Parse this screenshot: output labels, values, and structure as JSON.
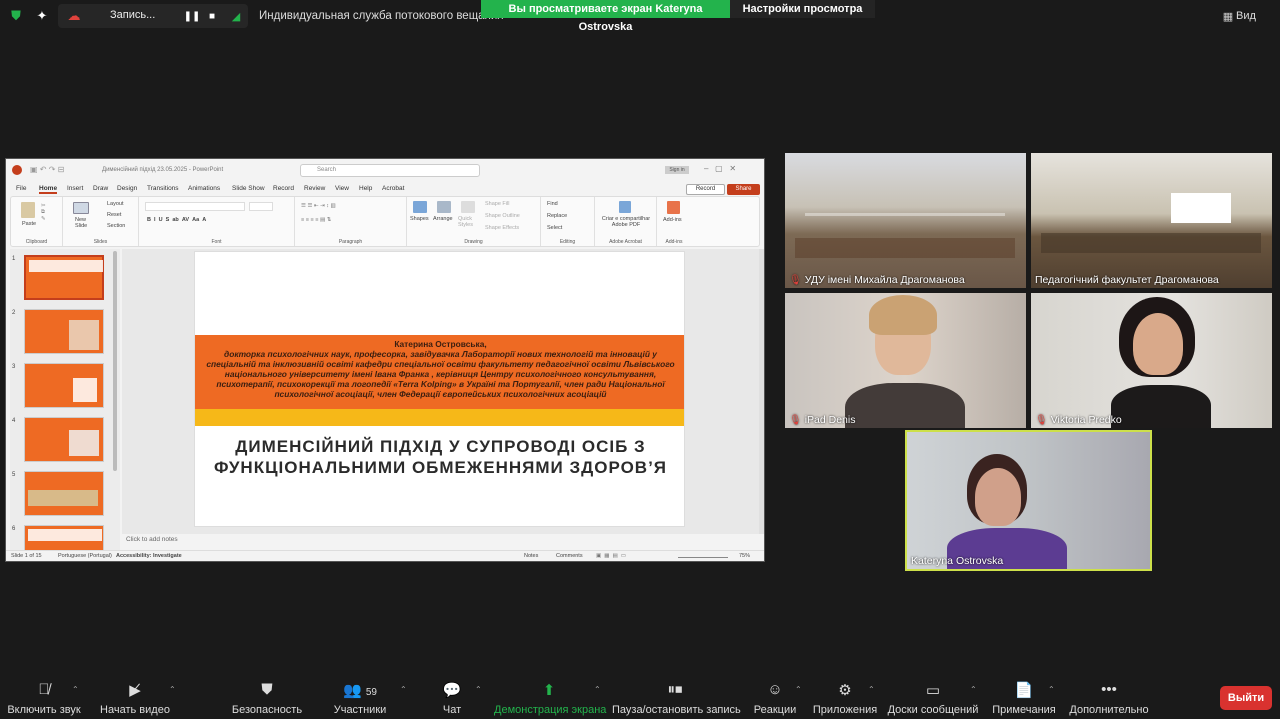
{
  "topbar": {
    "recording_label": "Запись...",
    "stream_text": "Индивидуальная служба потокового вещания",
    "share_banner": "Вы просматриваете экран Kateryna Ostrovska",
    "view_settings": "Настройки просмотра",
    "view_label": "Вид"
  },
  "ppt": {
    "doc_title": "Дименсійний підхід 23.05.2025 - PowerPoint",
    "search_placeholder": "Search",
    "sign_in": "Sign in",
    "tabs": [
      "File",
      "Home",
      "Insert",
      "Draw",
      "Design",
      "Transitions",
      "Animations",
      "Slide Show",
      "Record",
      "Review",
      "View",
      "Help",
      "Acrobat"
    ],
    "record_btn": "Record",
    "share_btn": "Share",
    "ribbon": {
      "clipboard": {
        "paste": "Paste",
        "label": "Clipboard"
      },
      "slides": {
        "new_slide": "New Slide",
        "layout": "Layout",
        "reset": "Reset",
        "section": "Section",
        "label": "Slides"
      },
      "font": {
        "label": "Font"
      },
      "paragraph": {
        "label": "Paragraph"
      },
      "drawing": {
        "shapes": "Shapes",
        "arrange": "Arrange",
        "quick_styles": "Quick Styles",
        "shape_fill": "Shape Fill",
        "shape_outline": "Shape Outline",
        "shape_effects": "Shape Effects",
        "label": "Drawing"
      },
      "editing": {
        "find": "Find",
        "replace": "Replace",
        "select": "Select",
        "label": "Editing"
      },
      "adobe": {
        "create": "Criar e compartilhar Adobe PDF",
        "label": "Adobe Acrobat"
      },
      "addins": {
        "addins": "Add-ins",
        "label": "Add-ins"
      }
    },
    "thumb_numbers": [
      "1",
      "2",
      "3",
      "4",
      "5",
      "6"
    ],
    "slide": {
      "author_name": "Катерина Островська,",
      "author_desc": "докторка психологічних наук, професорка, завідувачка Лабораторії нових технологій та інновацій у спеціальній та інклюзивній освіті кафедри спеціальної освіти факультету педагогічної освіти Львівського національного університету імені Івана Франка , керівниця Центру психологічного консультування, психотерапії, психокорекції та логопедії «Terra Kolping» в Україні та Португалії, член ради Національної психологічної асоціації, член Федерації європейських психологічних асоціацій",
      "title": "ДИМЕНСІЙНИЙ ПІДХІД У СУПРОВОДІ ОСІБ З ФУНКЦІОНАЛЬНИМИ ОБМЕЖЕННЯМИ ЗДОРОВ’Я"
    },
    "notes_placeholder": "Click to add notes",
    "status": {
      "slide_count": "Slide 1 of 15",
      "language": "Portuguese (Portugal)",
      "accessibility": "Accessibility: Investigate",
      "notes": "Notes",
      "comments": "Comments",
      "zoom": "75%"
    }
  },
  "tiles": [
    {
      "name": "УДУ імені Михайла Драгоманова"
    },
    {
      "name": "Педагогічний факультет Драгоманова"
    },
    {
      "name": "iPad Denis"
    },
    {
      "name": "Viktoria Predko"
    },
    {
      "name": "Kateryna Ostrovska"
    }
  ],
  "bottombar": {
    "mute": "Включить звук",
    "video": "Начать видео",
    "security": "Безопасность",
    "participants": "Участники",
    "participants_count": "59",
    "chat": "Чат",
    "share": "Демонстрация экрана",
    "pause_rec": "Пауза/остановить запись",
    "reactions": "Реакции",
    "apps": "Приложения",
    "whiteboards": "Доски сообщений",
    "notes": "Примечания",
    "more": "Дополнительно",
    "leave": "Выйти"
  },
  "colors": {
    "share_green": "#23b34c",
    "ppt_accent": "#c43e1c",
    "slide_orange": "#ee6a23",
    "slide_yellow": "#f6b818",
    "active_speaker": "#cde04a",
    "leave_red": "#d9322f"
  }
}
